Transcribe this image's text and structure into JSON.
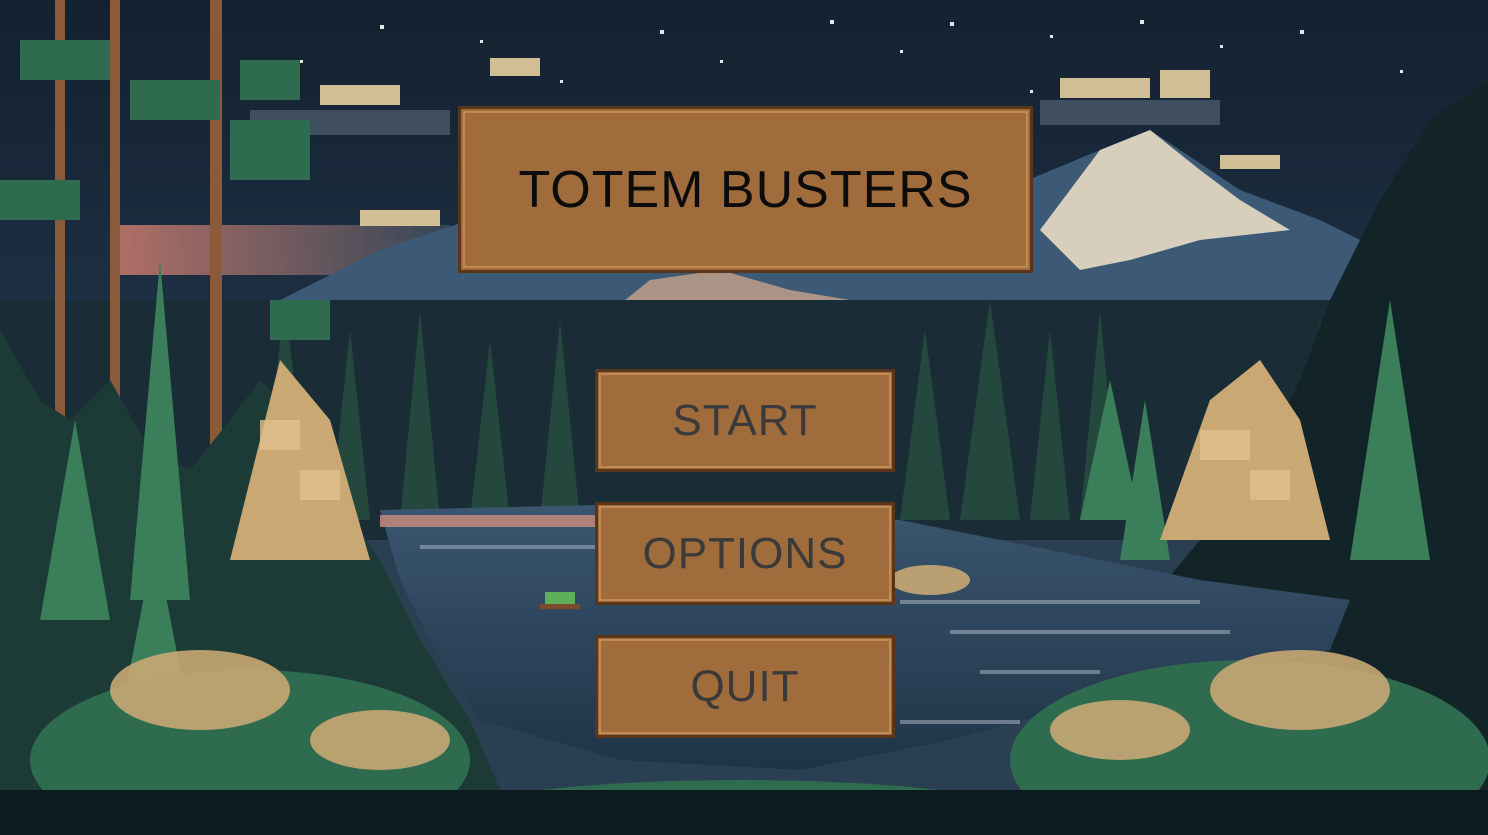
{
  "game": {
    "title": "TOTEM BUSTERS"
  },
  "menu": {
    "start_label": "START",
    "options_label": "OPTIONS",
    "quit_label": "QUIT"
  },
  "background": {
    "description_icon": "pixel-art-mountain-lake-night-scene",
    "colors": {
      "sky": "#17283a",
      "mountain": "#3c5a76",
      "snow": "#e8dcc4",
      "forest": "#2f6b4f",
      "foliage_light": "#c9a874",
      "lake": "#33536e",
      "panel": "#a06c3c",
      "panel_border": "#5a3519"
    }
  }
}
